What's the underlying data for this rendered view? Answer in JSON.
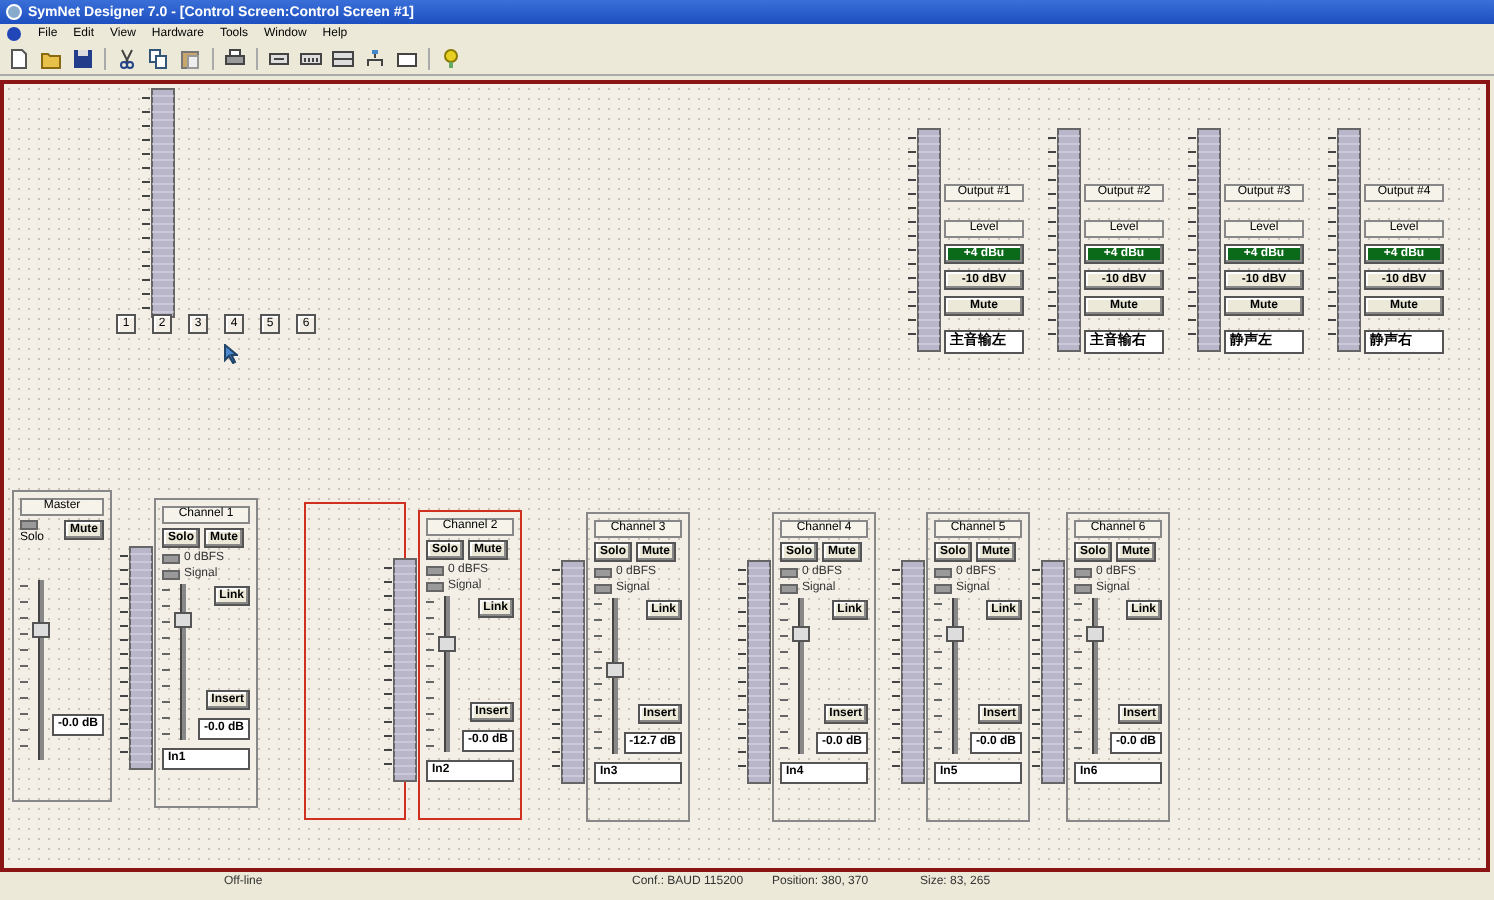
{
  "window": {
    "title": "SymNet Designer 7.0 - [Control Screen:Control Screen #1]"
  },
  "menu": [
    "File",
    "Edit",
    "View",
    "Hardware",
    "Tools",
    "Window",
    "Help"
  ],
  "presets": [
    "1",
    "2",
    "3",
    "4",
    "5",
    "6"
  ],
  "outputs": [
    {
      "title": "Output #1",
      "level_label": "Level",
      "ranges": [
        {
          "label": "+4 dBu",
          "selected": true
        },
        {
          "label": "-10 dBV",
          "selected": false
        }
      ],
      "mute": "Mute",
      "name": "主音输左"
    },
    {
      "title": "Output #2",
      "level_label": "Level",
      "ranges": [
        {
          "label": "+4 dBu",
          "selected": true
        },
        {
          "label": "-10 dBV",
          "selected": false
        }
      ],
      "mute": "Mute",
      "name": "主音输右"
    },
    {
      "title": "Output #3",
      "level_label": "Level",
      "ranges": [
        {
          "label": "+4 dBu",
          "selected": true
        },
        {
          "label": "-10 dBV",
          "selected": false
        }
      ],
      "mute": "Mute",
      "name": "静声左"
    },
    {
      "title": "Output #4",
      "level_label": "Level",
      "ranges": [
        {
          "label": "+4 dBu",
          "selected": true
        },
        {
          "label": "-10 dBV",
          "selected": false
        }
      ],
      "mute": "Mute",
      "name": "静声右"
    }
  ],
  "master": {
    "title": "Master",
    "solo": "Solo",
    "solo_on": false,
    "mute": "Mute",
    "level": 0.75,
    "reading": "-0.0 dB"
  },
  "modules": [
    {
      "kind": "channel",
      "selected": false,
      "title": "Channel 1",
      "solo": "Solo",
      "mute": "Mute",
      "leds": [
        "0 dBFS",
        "Signal"
      ],
      "link": "Link",
      "level": 0.8,
      "insert": "Insert",
      "reading": "-0.0 dB",
      "name": "In1"
    },
    {
      "kind": "empty",
      "selected": true
    },
    {
      "kind": "channel",
      "selected": true,
      "title": "Channel 2",
      "solo": "Solo",
      "mute": "Mute",
      "leds": [
        "0 dBFS",
        "Signal"
      ],
      "link": "Link",
      "level": 0.72,
      "insert": "Insert",
      "reading": "-0.0 dB",
      "name": "In2"
    },
    {
      "kind": "channel",
      "selected": false,
      "title": "Channel 3",
      "solo": "Solo",
      "mute": "Mute",
      "leds": [
        "0 dBFS",
        "Signal"
      ],
      "link": "Link",
      "level": 0.55,
      "insert": "Insert",
      "reading": "-12.7 dB",
      "name": "In3"
    },
    {
      "kind": "channel",
      "selected": false,
      "title": "Channel 4",
      "solo": "Solo",
      "mute": "Mute",
      "leds": [
        "0 dBFS",
        "Signal"
      ],
      "link": "Link",
      "level": 0.8,
      "insert": "Insert",
      "reading": "-0.0 dB",
      "name": "In4"
    },
    {
      "kind": "channel",
      "selected": false,
      "title": "Channel 5",
      "solo": "Solo",
      "mute": "Mute",
      "leds": [
        "0 dBFS",
        "Signal"
      ],
      "link": "Link",
      "level": 0.8,
      "insert": "Insert",
      "reading": "-0.0 dB",
      "name": "In5"
    },
    {
      "kind": "channel",
      "selected": false,
      "title": "Channel 6",
      "solo": "Solo",
      "mute": "Mute",
      "leds": [
        "0 dBFS",
        "Signal"
      ],
      "link": "Link",
      "level": 0.8,
      "insert": "Insert",
      "reading": "-0.0 dB",
      "name": "In6"
    }
  ],
  "status_bar": {
    "state": "Off-line",
    "conf": "Conf.: BAUD 115200",
    "position": "Position: 380, 370",
    "size": "Size: 83, 265"
  }
}
